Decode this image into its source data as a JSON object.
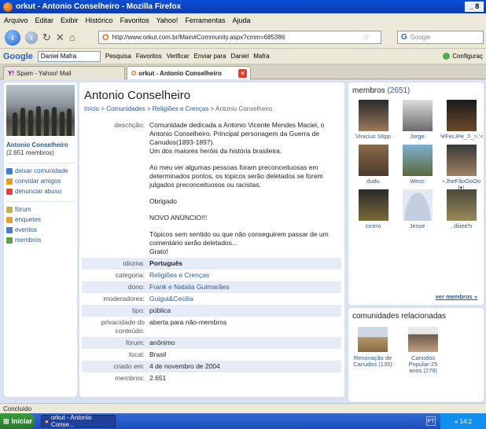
{
  "window": {
    "title": "orkut - Antonio Conselheiro - Mozilla Firefox",
    "controls": "_ 8"
  },
  "menu": [
    "Arquivo",
    "Editar",
    "Exibir",
    "Histórico",
    "Favoritos",
    "Yahoo!",
    "Ferramentas",
    "Ajuda"
  ],
  "nav": {
    "url": "http://www.orkut.com.br/Main#Community.aspx?cmm=685386",
    "search_placeholder": "Google"
  },
  "gbar": {
    "logo": "Google",
    "user": "Daniel Mafra",
    "pesquisa": "Pesquisa",
    "favoritos": "Favoritos",
    "verificar": "Verificar",
    "enviar": "Enviar para",
    "daniel": "Daniel",
    "mafra": "Mafra",
    "config": "Configuraç"
  },
  "tabs": [
    {
      "label": "Spam - Yahoo! Mail"
    },
    {
      "label": "orkut - Antonio Conselheiro"
    }
  ],
  "left": {
    "name": "Antonio Conselheiro",
    "members": "(2.651 membros)",
    "actions": [
      "deixar comunidade",
      "convidar amigos",
      "denunciar abuso"
    ],
    "menu": [
      "fórum",
      "enquetes",
      "eventos",
      "membros"
    ]
  },
  "main": {
    "title": "Antonio Conselheiro",
    "breadcrumb": {
      "inicio": "Início",
      "sep": " > ",
      "comunidades": "Comunidades",
      "categoria": "Religiões e Crenças",
      "atual": "Antonio Conselheiro"
    },
    "description_label": "descrição:",
    "description": [
      "Comunidade dedicada a Antonio Vicente Mendes Maciel, o Antonio Conselheiro. Principal personagem da Guerra de Canudos(1893-1897).\nUm dos maiores heróis da história brasileira.",
      "Ao meu ver algumas pessoas foram preconceituosas em determinados pontos, os topicos serão deletados se forem julgados preconceituosos ou racistas.",
      "Obrigado",
      "NOVO ANÚNCIO!!!",
      "Tópicos sem sentido ou que não conseguirem passar de um comentário serão deletados...\nGrato!"
    ],
    "rows": [
      {
        "label": "idioma:",
        "value": "Português"
      },
      {
        "label": "categoria:",
        "value": "Religiões e Crenças"
      },
      {
        "label": "dono:",
        "value": "Frank e Natalia Guimarães"
      },
      {
        "label": "moderadores:",
        "value": "Guigui&Cecilia"
      },
      {
        "label": "tipo:",
        "value": "pública"
      },
      {
        "label": "privacidade do conteúdo:",
        "value": "aberta para não-membros"
      },
      {
        "label": "fórum:",
        "value": "anônimo"
      },
      {
        "label": "local:",
        "value": "Brasil"
      },
      {
        "label": "criado em:",
        "value": "4 de novembro de 2004"
      },
      {
        "label": "membros:",
        "value": "2.651"
      }
    ]
  },
  "members": {
    "heading": "membros",
    "count": "(2651)",
    "list": [
      "Vinicius Stipp",
      "Jorge",
      "ΨFeLiPe_/\\_>,'<",
      "dudu",
      "Wess",
      "⋆JheFãoOoOo l♦!",
      "cicero",
      "Jesse",
      ", diiiee'h"
    ],
    "more": "ver membros »"
  },
  "related": {
    "heading": "comunidades relacionadas",
    "list": [
      "Renovação de Canudos (135)",
      "Canudos Popular-25 anos (279)"
    ]
  },
  "status": "Concluído",
  "taskbar": {
    "start": "Iniciar",
    "task": "orkut - Antonio Conse...",
    "lang": "PT",
    "clock": "« 14:2"
  }
}
